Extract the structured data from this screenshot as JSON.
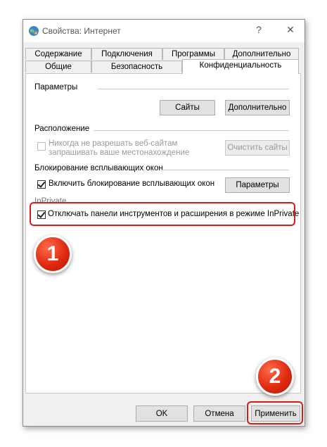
{
  "window": {
    "title": "Свойства: Интернет",
    "help_glyph": "?",
    "close_glyph": "✕"
  },
  "tabs": {
    "row1": [
      "Содержание",
      "Подключения",
      "Программы",
      "Дополнительно"
    ],
    "row2": [
      "Общие",
      "Безопасность",
      "Конфиденциальность"
    ],
    "active": "Конфиденциальность"
  },
  "settings": {
    "title": "Параметры",
    "sites_button": "Сайты",
    "advanced_button": "Дополнительно"
  },
  "location": {
    "title": "Расположение",
    "checkbox_line1": "Никогда не разрешать веб-сайтам",
    "checkbox_line2": "запрашивать ваше местонахождение",
    "checkbox_checked": false,
    "checkbox_enabled": false,
    "clear_sites_button": "Очистить сайты"
  },
  "popup": {
    "title": "Блокирование всплывающих окон",
    "checkbox_label": "Включить блокирование всплывающих окон",
    "checkbox_checked": true,
    "settings_button": "Параметры"
  },
  "inprivate": {
    "title": "InPrivate",
    "checkbox_label": "Отключать панели инструментов и расширения в режиме InPrivate",
    "checkbox_checked": true
  },
  "buttons": {
    "ok": "OK",
    "cancel": "Отмена",
    "apply": "Применить"
  },
  "annotations": {
    "badge1": "1",
    "badge2": "2",
    "highlight_color": "#d11f1f"
  }
}
